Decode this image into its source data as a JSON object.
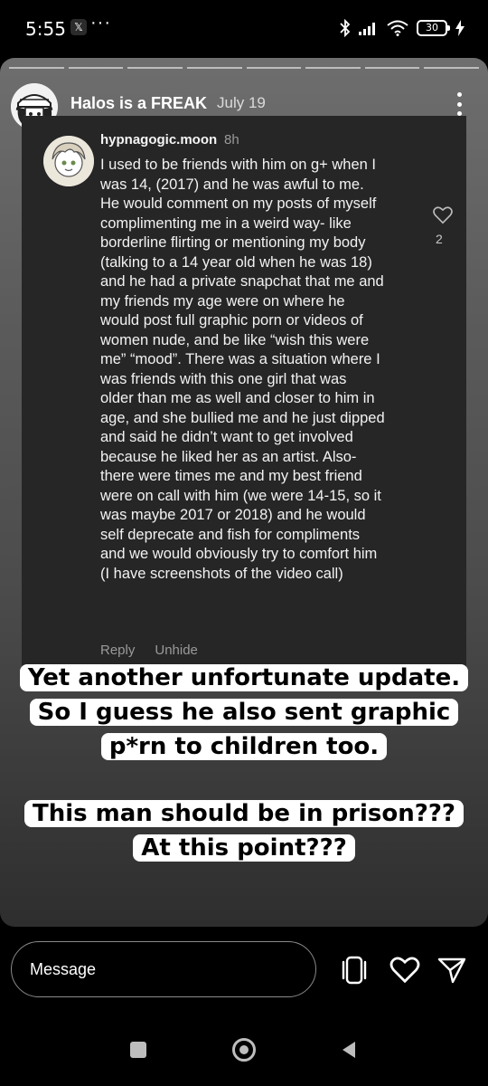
{
  "status_bar": {
    "time": "5:55",
    "app_badge": "𝕏",
    "more": "···",
    "battery": "30",
    "icons": [
      "bluetooth-icon",
      "signal-icon",
      "wifi-icon",
      "battery-icon",
      "charging-icon"
    ]
  },
  "story": {
    "username": "Halos is a FREAK",
    "posted": "July 19",
    "progress_segments": 8,
    "comment": {
      "handle": "hypnagogic.moon",
      "age": "8h",
      "text": "I used to be friends with him on g+ when I\nwas 14, (2017) and he was awful to me.\nHe would comment on my posts of myself\ncomplimenting me in a weird way- like\nborderline flirting or mentioning my body\n(talking to a 14 year old when he was 18)\nand he had a private snapchat that me and\nmy friends my age were on where he\nwould post full graphic porn or videos of\nwomen nude, and be like “wish this were\nme” “mood”. There was a situation where I\nwas friends with this one girl that was\nolder than me as well and closer to him in\nage, and she bullied me and he just dipped\nand said he didn’t want to get involved\nbecause he liked her as an artist. Also-\nthere were times me and my best friend\nwere on call with him (we were 14-15, so it\nwas maybe 2017 or 2018) and he would\nself deprecate and fish for compliments\nand we would obviously try to comfort him\n(I have screenshots of the video call)",
      "likes": "2",
      "reply_label": "Reply",
      "unhide_label": "Unhide"
    },
    "caption_1": [
      "Yet another unfortunate update.",
      "So I guess he also sent graphic",
      "p*rn to children too."
    ],
    "caption_2": [
      "This man should be in prison???",
      "At this point???"
    ]
  },
  "message_bar": {
    "placeholder": "Message",
    "icons": [
      "stickers-icon",
      "like-heart-icon",
      "send-icon"
    ]
  },
  "nav_bar": {
    "icons": [
      "recents-square-icon",
      "home-circle-icon",
      "back-triangle-icon"
    ]
  },
  "colors": {
    "background": "#000000",
    "comment_bg": "#262626",
    "caption_bg": "#ffffff"
  }
}
